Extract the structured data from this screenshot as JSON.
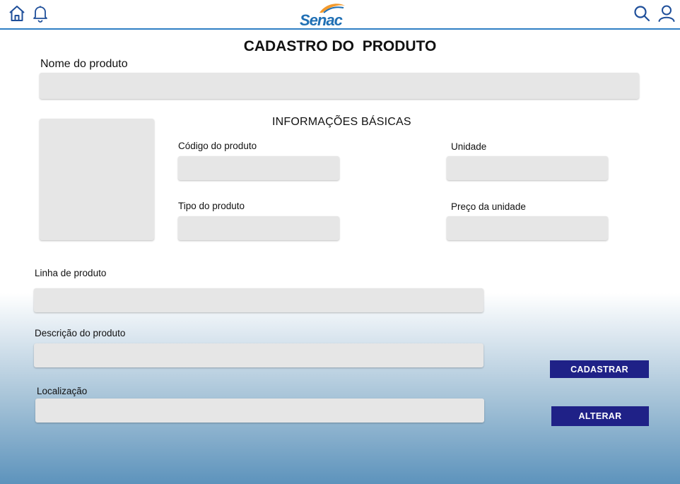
{
  "header": {
    "logo_text": "Senac",
    "icons": [
      "home-icon",
      "bell-icon",
      "search-icon",
      "user-icon"
    ]
  },
  "page": {
    "title": "CADASTRO DO  PRODUTO"
  },
  "form": {
    "nome_label": "Nome do produto",
    "nome_value": "",
    "basic_info_title": "INFORMAÇÕES BÁSICAS",
    "codigo_label": "Código do produto",
    "unidade_label": "Unidade",
    "tipo_label": "Tipo do produto",
    "preco_label": "Preço da unidade",
    "linha_label": "Linha de produto",
    "descricao_label": "Descrição do produto",
    "localizacao_label": "Localização"
  },
  "actions": {
    "cadastrar_label": "CADASTRAR",
    "alterar_label": "ALTERAR"
  },
  "colors": {
    "header_line": "#2f7fc4",
    "field_bg": "#e6e6e6",
    "button_bg": "#1f2187",
    "logo_blue": "#1f6fb4",
    "logo_orange": "#f39a2d"
  }
}
